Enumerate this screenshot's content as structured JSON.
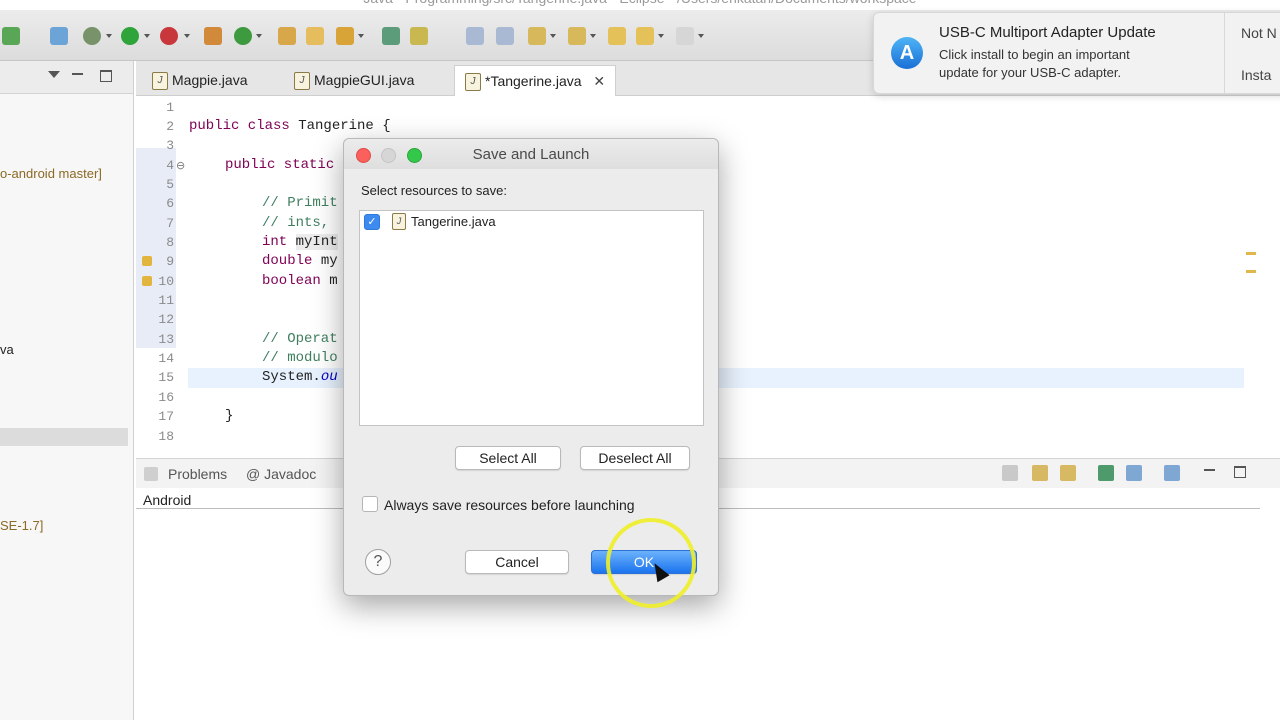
{
  "window": {
    "title": "Java - Programming/src/Tangerine.java - Eclipse - /Users/erikatan/Documents/workspace"
  },
  "left_panel": {
    "items": [
      {
        "text": "o-android master]"
      },
      {
        "text": "va"
      },
      {
        "text": "SE-1.7]"
      }
    ]
  },
  "editor_tabs": [
    {
      "label": "Magpie.java",
      "active": false
    },
    {
      "label": "MagpieGUI.java",
      "active": false
    },
    {
      "label": "*Tangerine.java",
      "active": true
    }
  ],
  "editor": {
    "line_numbers": [
      "1",
      "2",
      "3",
      "4",
      "5",
      "6",
      "7",
      "8",
      "9",
      "10",
      "11",
      "12",
      "13",
      "14",
      "15",
      "16",
      "17",
      "18"
    ],
    "lines": {
      "l2_kw": "public class ",
      "l2_rest": "Tangerine {",
      "l4": "public static",
      "l6": "// Primit",
      "l7": "// ints,",
      "l8_kw": "int ",
      "l8_rest": "myInt",
      "l9_kw": "double ",
      "l9_rest": "my",
      "l10_kw": "boolean ",
      "l10_rest": "m",
      "l13": "// Operat",
      "l14": "// modulo",
      "l15_a": "System.",
      "l15_b": "ou",
      "l17": "}"
    }
  },
  "bottom_views": {
    "tabs": [
      "Problems",
      "@ Javadoc"
    ],
    "content_label": "Android"
  },
  "notification": {
    "title": "USB-C Multiport Adapter Update",
    "body": "Click install to begin an important update for your USB-C adapter.",
    "actions": [
      "Not N",
      "Insta"
    ]
  },
  "dialog": {
    "title": "Save and Launch",
    "prompt": "Select resources to save:",
    "resources": [
      {
        "name": "Tangerine.java",
        "checked": true
      }
    ],
    "select_all_label": "Select All",
    "deselect_all_label": "Deselect All",
    "always_save_label": "Always save resources before launching",
    "always_save_checked": false,
    "cancel_label": "Cancel",
    "ok_label": "OK",
    "help_glyph": "?"
  }
}
